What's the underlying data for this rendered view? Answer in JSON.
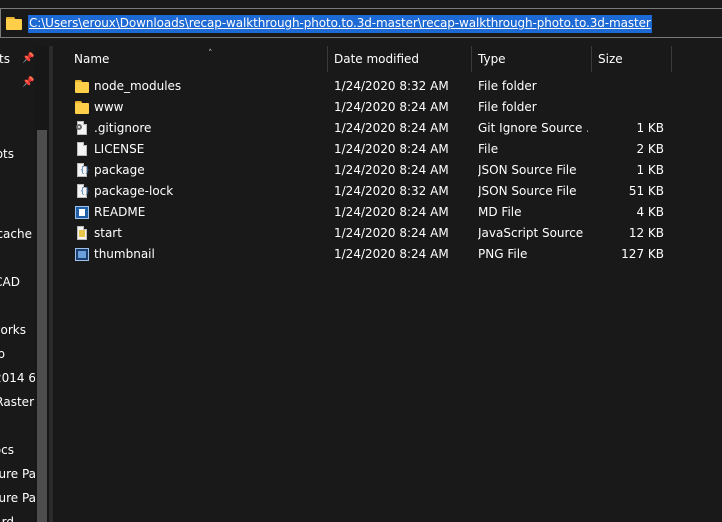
{
  "address": {
    "path": "C:\\Users\\eroux\\Downloads\\recap-walkthrough-photo.to.3d-master\\recap-walkthrough-photo.to.3d-master"
  },
  "nav": {
    "items": [
      {
        "label": "ts",
        "pinned": true
      },
      {
        "label": "",
        "pinned": true
      },
      {
        "label": "ots",
        "pinned": false
      },
      {
        "label": "cache",
        "pinned": false
      },
      {
        "label": "CAD",
        "pinned": false
      },
      {
        "label": "vorks",
        "pinned": false
      },
      {
        "label": "p",
        "pinned": false
      },
      {
        "label": "2014 6",
        "pinned": false
      },
      {
        "label": "Raster",
        "pinned": false
      },
      {
        "label": "ocs",
        "pinned": false
      },
      {
        "label": "ture Pa",
        "pinned": false
      },
      {
        "label": "ture Pa",
        "pinned": false
      },
      {
        "label": "rd",
        "pinned": false
      }
    ]
  },
  "columns": {
    "name": "Name",
    "date": "Date modified",
    "type": "Type",
    "size": "Size"
  },
  "files": [
    {
      "name": "node_modules",
      "date": "1/24/2020 8:32 AM",
      "type": "File folder",
      "size": "",
      "icon": "folder-icon"
    },
    {
      "name": "www",
      "date": "1/24/2020 8:24 AM",
      "type": "File folder",
      "size": "",
      "icon": "folder-icon"
    },
    {
      "name": ".gitignore",
      "date": "1/24/2020 8:24 AM",
      "type": "Git Ignore Source ...",
      "size": "1 KB",
      "icon": "gear-file-icon"
    },
    {
      "name": "LICENSE",
      "date": "1/24/2020 8:24 AM",
      "type": "File",
      "size": "2 KB",
      "icon": "blank-file-icon"
    },
    {
      "name": "package",
      "date": "1/24/2020 8:24 AM",
      "type": "JSON Source File",
      "size": "1 KB",
      "icon": "json-file-icon"
    },
    {
      "name": "package-lock",
      "date": "1/24/2020 8:32 AM",
      "type": "JSON Source File",
      "size": "51 KB",
      "icon": "json-file-icon"
    },
    {
      "name": "README",
      "date": "1/24/2020 8:24 AM",
      "type": "MD File",
      "size": "4 KB",
      "icon": "markdown-file-icon"
    },
    {
      "name": "start",
      "date": "1/24/2020 8:24 AM",
      "type": "JavaScript Source ...",
      "size": "12 KB",
      "icon": "javascript-file-icon"
    },
    {
      "name": "thumbnail",
      "date": "1/24/2020 8:24 AM",
      "type": "PNG File",
      "size": "127 KB",
      "icon": "image-file-icon"
    }
  ],
  "colors": {
    "background": "#191919",
    "selection": "#1e6ad5",
    "folder": "#ffcf4a"
  }
}
